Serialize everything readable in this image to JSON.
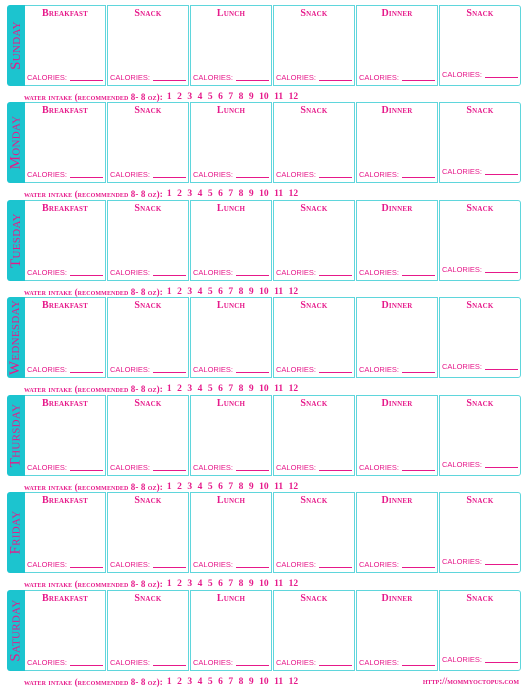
{
  "meal_titles": [
    "Breakfast",
    "Snack",
    "Lunch",
    "Snack",
    "Dinner",
    "Snack"
  ],
  "calories_label": "CALORIES:",
  "water": {
    "label": "water intake (recommended 8- 8 oz):",
    "numbers": [
      "1",
      "2",
      "3",
      "4",
      "5",
      "6",
      "7",
      "8",
      "9",
      "10",
      "11",
      "12"
    ]
  },
  "days": [
    {
      "name": "Sunday"
    },
    {
      "name": "Monday"
    },
    {
      "name": "Tuesday"
    },
    {
      "name": "Wednesday"
    },
    {
      "name": "Thursday"
    },
    {
      "name": "Friday"
    },
    {
      "name": "Saturday"
    }
  ],
  "footer": {
    "url": "http://mommyoctopus.com"
  },
  "colors": {
    "accent_pink": "#e6198a",
    "tab_teal": "#1cc4cf",
    "border_teal": "#5fd6dc"
  }
}
